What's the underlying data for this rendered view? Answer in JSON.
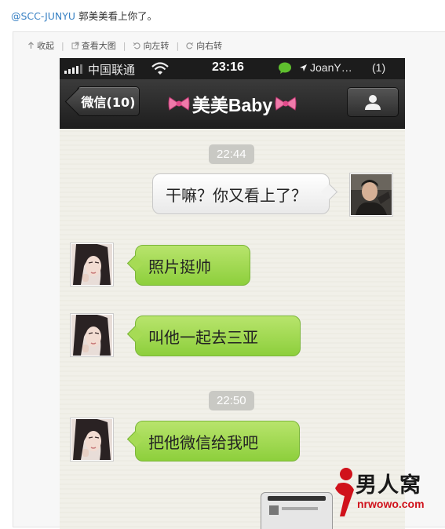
{
  "post": {
    "mention": "@SCC-JUNYU",
    "text": "郭美美看上你了。"
  },
  "toolbar": {
    "collapse": "收起",
    "view_large": "查看大图",
    "rotate_left": "向左转",
    "rotate_right": "向右转"
  },
  "phone": {
    "statusbar": {
      "carrier": "中国联通",
      "time": "23:16",
      "user": "JoanY…",
      "badge_count": "(1)"
    },
    "nav": {
      "back_label": "微信(10)",
      "title": "美美Baby"
    },
    "chat": [
      {
        "type": "time",
        "text": "22:44"
      },
      {
        "type": "message",
        "side": "out",
        "text": "干嘛？你又看上了？"
      },
      {
        "type": "message",
        "side": "in",
        "text": "照片挺帅"
      },
      {
        "type": "message",
        "side": "in",
        "text": "叫他一起去三亚"
      },
      {
        "type": "time",
        "text": "22:50"
      },
      {
        "type": "message",
        "side": "in",
        "text": "把他微信给我吧"
      }
    ]
  },
  "watermark": {
    "title": "男人窝",
    "url": "nrwowo.com"
  },
  "colors": {
    "mention": "#3a82c4",
    "bubble_in": "#9bd64a",
    "bubble_out": "#f3f3f3",
    "navbar": "#2a2a2a"
  },
  "icons": [
    "collapse-arrow-icon",
    "external-link-icon",
    "rotate-left-icon",
    "rotate-right-icon",
    "signal-bars-icon",
    "wifi-icon",
    "wechat-icon",
    "location-arrow-icon",
    "bow-icon",
    "user-silhouette-icon",
    "watermark-logo-icon"
  ]
}
